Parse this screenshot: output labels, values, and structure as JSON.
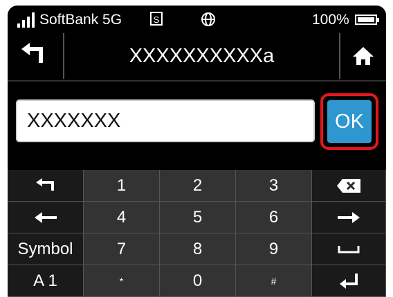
{
  "status_bar": {
    "carrier": "SoftBank 5G",
    "sim_label": "S",
    "battery_percent": "100%",
    "signal_icon": "signal-bars-icon",
    "globe_icon": "globe-icon"
  },
  "header": {
    "title": "XXXXXXXXXXa",
    "back_icon": "back-arrow-icon",
    "home_icon": "home-icon"
  },
  "input": {
    "value": "XXXXXXX",
    "ok_label": "OK",
    "highlight_color": "#e3161c",
    "ok_color": "#2e97d0"
  },
  "keypad": {
    "rows": [
      [
        "",
        "1",
        "2",
        "3",
        ""
      ],
      [
        "",
        "4",
        "5",
        "6",
        ""
      ],
      [
        "Symbol",
        "7",
        "8",
        "9",
        ""
      ],
      [
        "A 1",
        "*",
        "0",
        "#",
        ""
      ]
    ],
    "icons": {
      "undo": "undo-icon",
      "backspace": "backspace-icon",
      "left": "left-arrow-icon",
      "right": "right-arrow-icon",
      "space": "space-icon",
      "enter": "enter-icon"
    }
  }
}
